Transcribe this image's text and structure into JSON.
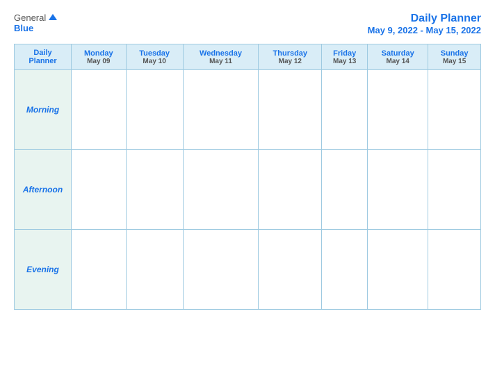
{
  "logo": {
    "general": "General",
    "blue": "Blue"
  },
  "title": {
    "main": "Daily Planner",
    "dates": "May 9, 2022 - May 15, 2022"
  },
  "table": {
    "header_label_line1": "Daily",
    "header_label_line2": "Planner",
    "days": [
      {
        "name": "Monday",
        "date": "May 09"
      },
      {
        "name": "Tuesday",
        "date": "May 10"
      },
      {
        "name": "Wednesday",
        "date": "May 11"
      },
      {
        "name": "Thursday",
        "date": "May 12"
      },
      {
        "name": "Friday",
        "date": "May 13"
      },
      {
        "name": "Saturday",
        "date": "May 14"
      },
      {
        "name": "Sunday",
        "date": "May 15"
      }
    ],
    "periods": [
      {
        "label": "Morning"
      },
      {
        "label": "Afternoon"
      },
      {
        "label": "Evening"
      }
    ]
  }
}
